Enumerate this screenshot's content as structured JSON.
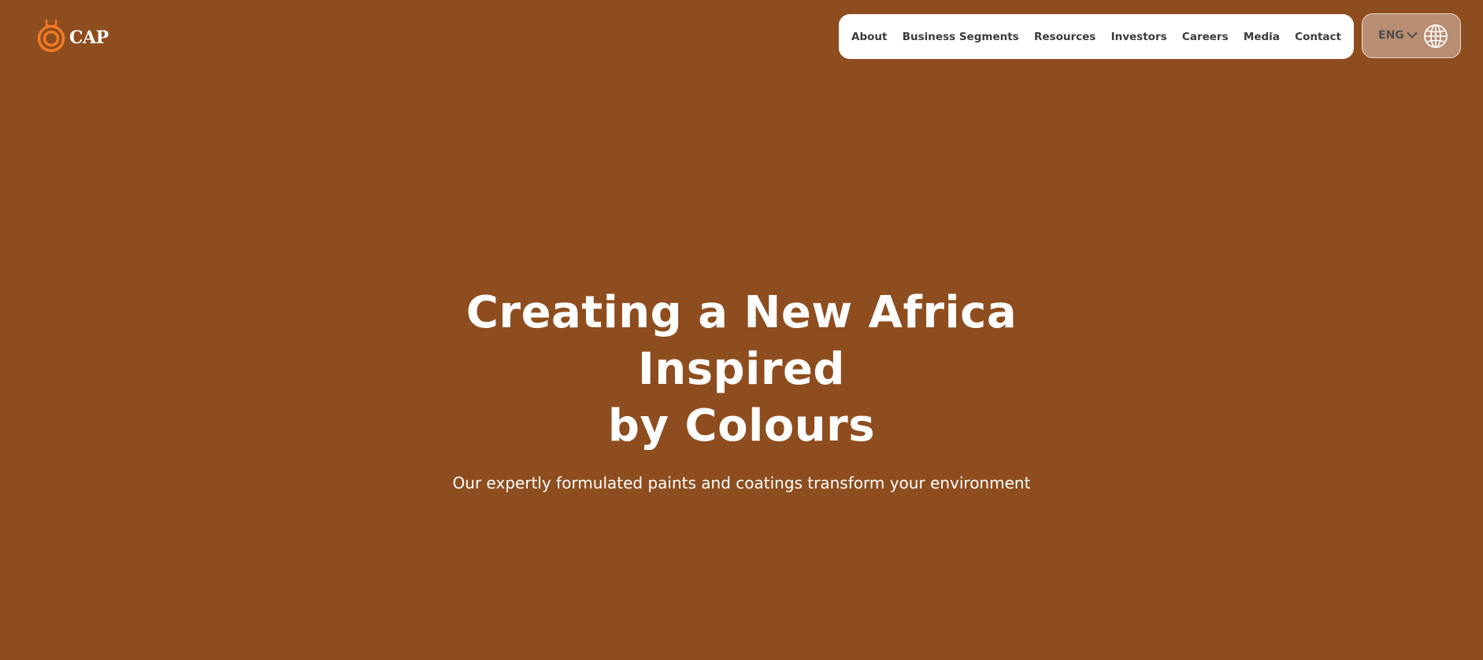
{
  "brand": {
    "name": "CAP",
    "accent_color": "#f07a26"
  },
  "nav": {
    "items": [
      {
        "label": "About"
      },
      {
        "label": "Business Segments"
      },
      {
        "label": "Resources"
      },
      {
        "label": "Investors"
      },
      {
        "label": "Careers"
      },
      {
        "label": "Media"
      },
      {
        "label": "Contact"
      }
    ]
  },
  "language": {
    "label": "ENG",
    "icons": [
      "chevron-down-icon",
      "globe-icon"
    ]
  },
  "hero": {
    "title_line1": "Creating a New Africa Inspired",
    "title_line2": "by Colours",
    "subtitle": "Our expertly formulated paints and coatings transform your environment"
  },
  "colors": {
    "background": "#8e4d1e",
    "nav_background": "#ffffff",
    "nav_text": "#3b3b3b",
    "language_background": "#b98e72",
    "hero_text": "#ffffff"
  }
}
